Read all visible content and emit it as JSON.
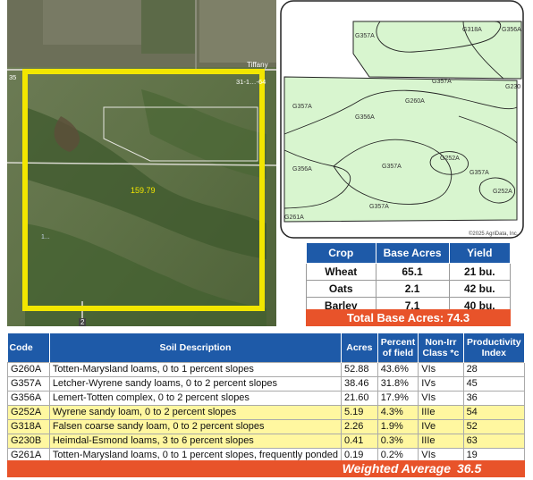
{
  "aerial": {
    "acres_label": "159.79",
    "town_label": "Tiffany",
    "section_label": "31-1…-64",
    "road_number": "2",
    "left_edge_number": "35",
    "field_number": "1..."
  },
  "soil_map": {
    "labels": [
      "G357A",
      "G318A",
      "G356A",
      "G230",
      "G260A",
      "G357A",
      "G357A",
      "G356A",
      "G252A",
      "G356A",
      "G357A",
      "G357A",
      "G252A",
      "G357A",
      "G261A"
    ],
    "copyright": "©2025 AgriData, Inc."
  },
  "crop_table": {
    "headers": [
      "Crop",
      "Base Acres",
      "Yield"
    ],
    "rows": [
      {
        "crop": "Wheat",
        "base_acres": "65.1",
        "yield": "21 bu."
      },
      {
        "crop": "Oats",
        "base_acres": "2.1",
        "yield": "42 bu."
      },
      {
        "crop": "Barley",
        "base_acres": "7.1",
        "yield": "40 bu."
      }
    ],
    "total_label": "Total Base Acres: 74.3"
  },
  "soil_table": {
    "headers": {
      "code": "Code",
      "desc": "Soil Description",
      "acres": "Acres",
      "percent": "Percent of field",
      "class": "Non-Irr Class *c",
      "index": "Productivity Index"
    },
    "rows": [
      {
        "code": "G260A",
        "desc": "Totten-Marysland loams, 0 to 1 percent slopes",
        "acres": "52.88",
        "percent": "43.6%",
        "class": "VIs",
        "index": "28",
        "highlight": false
      },
      {
        "code": "G357A",
        "desc": "Letcher-Wyrene sandy loams, 0 to 2 percent slopes",
        "acres": "38.46",
        "percent": "31.8%",
        "class": "IVs",
        "index": "45",
        "highlight": false
      },
      {
        "code": "G356A",
        "desc": "Lemert-Totten complex, 0 to 2 percent slopes",
        "acres": "21.60",
        "percent": "17.9%",
        "class": "VIs",
        "index": "36",
        "highlight": false
      },
      {
        "code": "G252A",
        "desc": "Wyrene sandy loam, 0 to 2 percent slopes",
        "acres": "5.19",
        "percent": "4.3%",
        "class": "IIIe",
        "index": "54",
        "highlight": true
      },
      {
        "code": "G318A",
        "desc": "Falsen coarse sandy loam, 0 to 2 percent slopes",
        "acres": "2.26",
        "percent": "1.9%",
        "class": "IVe",
        "index": "52",
        "highlight": true
      },
      {
        "code": "G230B",
        "desc": "Heimdal-Esmond loams, 3 to 6 percent slopes",
        "acres": "0.41",
        "percent": "0.3%",
        "class": "IIIe",
        "index": "63",
        "highlight": true
      },
      {
        "code": "G261A",
        "desc": "Totten-Marysland loams, 0 to 1 percent slopes, frequently ponded",
        "acres": "0.19",
        "percent": "0.2%",
        "class": "VIs",
        "index": "19",
        "highlight": false
      }
    ],
    "weighted_label": "Weighted Average",
    "weighted_value": "36.5"
  },
  "colors": {
    "header_blue": "#1e5aa8",
    "total_orange": "#e8532a",
    "highlight_yellow": "#fff7a0",
    "boundary_yellow": "#f2e600",
    "soil_green": "#d8f5cf"
  }
}
